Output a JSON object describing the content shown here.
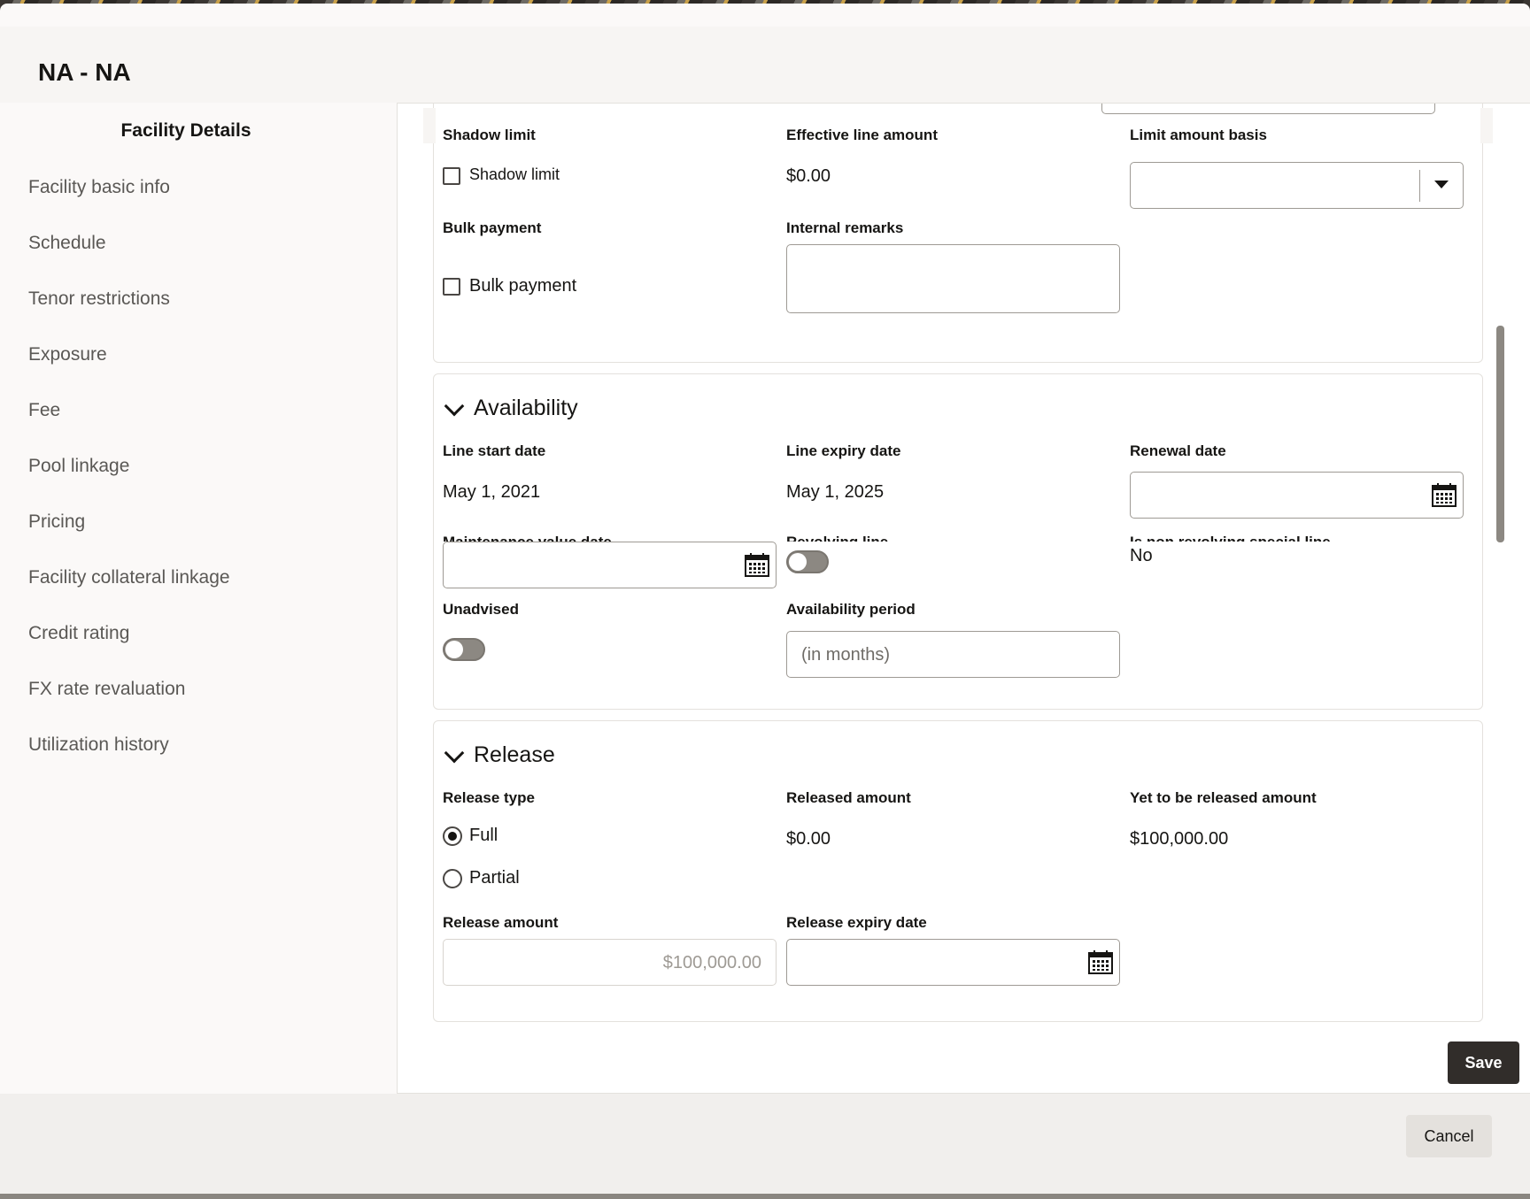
{
  "dialog": {
    "title": "NA - NA"
  },
  "sidebar": {
    "title": "Facility Details",
    "items": [
      {
        "label": "Facility basic info"
      },
      {
        "label": "Schedule"
      },
      {
        "label": "Tenor restrictions"
      },
      {
        "label": "Exposure"
      },
      {
        "label": "Fee"
      },
      {
        "label": "Pool linkage"
      },
      {
        "label": "Pricing"
      },
      {
        "label": "Facility collateral linkage"
      },
      {
        "label": "Credit rating"
      },
      {
        "label": "FX rate revaluation"
      },
      {
        "label": "Utilization history"
      }
    ]
  },
  "limits": {
    "shadow_limit_label": "Shadow limit",
    "shadow_limit_checkbox": "Shadow limit",
    "effective_line_amount_label": "Effective line amount",
    "effective_line_amount_value": "$0.00",
    "limit_amount_basis_label": "Limit amount basis",
    "limit_amount_basis_value": "",
    "bulk_payment_label": "Bulk payment",
    "bulk_payment_checkbox": "Bulk payment",
    "internal_remarks_label": "Internal remarks",
    "internal_remarks_value": ""
  },
  "availability": {
    "title": "Availability",
    "line_start_date_label": "Line start date",
    "line_start_date_value": "May 1, 2021",
    "line_expiry_date_label": "Line expiry date",
    "line_expiry_date_value": "May 1, 2025",
    "renewal_date_label": "Renewal date",
    "maintenance_value_date_label": "Maintenance value date",
    "revolving_line_label": "Revolving line",
    "is_non_revolving_label": "Is non revolving special line",
    "is_non_revolving_value": "No",
    "unadvised_label": "Unadvised",
    "availability_period_label": "Availability period",
    "availability_period_placeholder": "(in months)"
  },
  "release": {
    "title": "Release",
    "release_type_label": "Release type",
    "options": [
      {
        "label": "Full",
        "selected": true
      },
      {
        "label": "Partial",
        "selected": false
      }
    ],
    "released_amount_label": "Released amount",
    "released_amount_value": "$0.00",
    "yet_to_be_released_label": "Yet to be released amount",
    "yet_to_be_released_value": "$100,000.00",
    "release_amount_label": "Release amount",
    "release_amount_value": "$100,000.00",
    "release_expiry_date_label": "Release expiry date"
  },
  "actions": {
    "save_label": "Save",
    "cancel_label": "Cancel"
  },
  "colors": {
    "primary_button": "#312d2a",
    "toggle_off": "#8c8882"
  }
}
